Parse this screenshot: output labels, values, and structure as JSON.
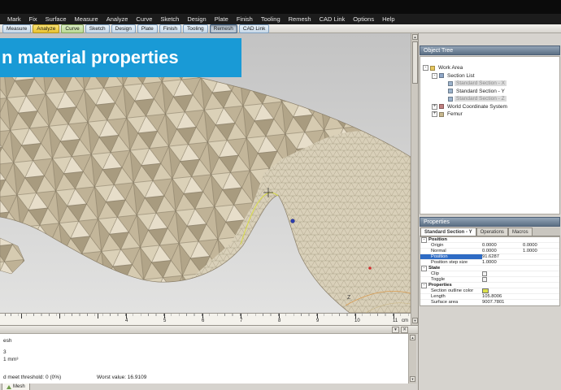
{
  "menu_bar": {
    "items": [
      "Mark",
      "Fix",
      "Surface",
      "Measure",
      "Analyze",
      "Curve",
      "Sketch",
      "Design",
      "Plate",
      "Finish",
      "Tooling",
      "Remesh",
      "CAD Link",
      "Options",
      "Help"
    ]
  },
  "toolbar": {
    "buttons": [
      {
        "label": "Measure",
        "style": "blue"
      },
      {
        "label": "Analyze",
        "style": "yellow"
      },
      {
        "label": "Curve",
        "style": "green"
      },
      {
        "label": "Sketch",
        "style": "blue"
      },
      {
        "label": "Design",
        "style": "blue"
      },
      {
        "label": "Plate",
        "style": "blue"
      },
      {
        "label": "Finish",
        "style": "blue"
      },
      {
        "label": "Tooling",
        "style": "blue"
      },
      {
        "label": "Remesh",
        "style": "pressed"
      },
      {
        "label": "CAD Link",
        "style": "blue"
      }
    ]
  },
  "banner": {
    "text": "n material properties",
    "color": "#199ad6"
  },
  "viewport": {
    "axis_label": "Z",
    "ruler": {
      "numbers": [
        "4",
        "5",
        "6",
        "7",
        "8",
        "9",
        "10",
        "11"
      ],
      "unit": "cm"
    }
  },
  "object_tree": {
    "title": "Object Tree",
    "items": [
      {
        "indent": 0,
        "expander": "-",
        "icon": "work-area-icon",
        "label": "Work Area",
        "disabled": false
      },
      {
        "indent": 1,
        "expander": "-",
        "icon": "section-list-icon",
        "label": "Section List",
        "disabled": false
      },
      {
        "indent": 2,
        "expander": "",
        "icon": "section-icon",
        "label": "Standard Section - X",
        "disabled": true
      },
      {
        "indent": 2,
        "expander": "",
        "icon": "section-icon",
        "label": "Standard Section - Y",
        "disabled": false
      },
      {
        "indent": 2,
        "expander": "",
        "icon": "section-icon",
        "label": "Standard Section - Z",
        "disabled": true
      },
      {
        "indent": 1,
        "expander": "+",
        "icon": "coordinate-system-icon",
        "label": "World Coordinate System",
        "disabled": false
      },
      {
        "indent": 1,
        "expander": "+",
        "icon": "mesh-icon",
        "label": "Femur",
        "disabled": false
      }
    ]
  },
  "properties": {
    "title": "Properties",
    "tabs": [
      {
        "label": "Standard Section - Y",
        "active": true
      },
      {
        "label": "Operations",
        "active": false
      },
      {
        "label": "Macros",
        "active": false
      }
    ],
    "rows": [
      {
        "type": "group",
        "label": "Position"
      },
      {
        "type": "value",
        "label": "Origin",
        "v1": "0.0000",
        "v2": "0.0000",
        "highlight": false
      },
      {
        "type": "value",
        "label": "Normal",
        "v1": "0.0000",
        "v2": "1.0000",
        "highlight": false
      },
      {
        "type": "value",
        "label": "Position",
        "v1": "91.6287",
        "v2": "",
        "highlight": true
      },
      {
        "type": "value",
        "label": "Position step size",
        "v1": "1.0000",
        "v2": "",
        "highlight": false
      },
      {
        "type": "group",
        "label": "State"
      },
      {
        "type": "checkbox",
        "label": "Clip"
      },
      {
        "type": "checkbox",
        "label": "Toggle"
      },
      {
        "type": "group",
        "label": "Properties"
      },
      {
        "type": "swatch",
        "label": "Section outline color",
        "swatch": "#dce04a"
      },
      {
        "type": "value",
        "label": "Length",
        "v1": "105.8006",
        "v2": "",
        "highlight": false
      },
      {
        "type": "value",
        "label": "Surface area",
        "v1": "9007.7801",
        "v2": "",
        "highlight": false
      }
    ]
  },
  "bottom_panel": {
    "lines": [
      "esh",
      "3",
      "1 mm³"
    ],
    "threshold_left": "d meet threshold: 0 (0%)",
    "threshold_right": "Worst value: 16.9109",
    "tab_label": "Mesh"
  },
  "colors": {
    "banner_blue": "#199ad6",
    "selection_blue": "#2e6bc4",
    "mesh_tan": "#cfc4aa",
    "section_outline_yellow": "#dce04a"
  }
}
